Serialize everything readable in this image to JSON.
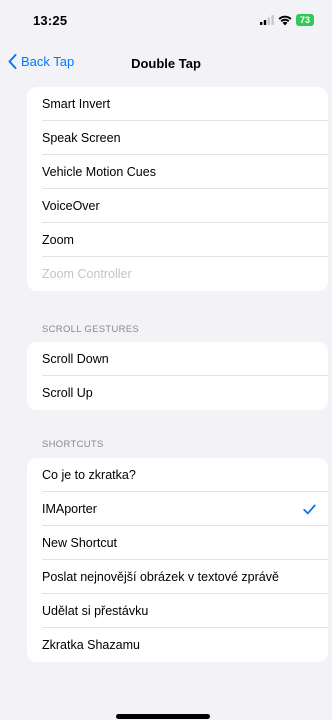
{
  "status_bar": {
    "time": "13:25",
    "battery": "73"
  },
  "nav": {
    "back_label": "Back Tap",
    "title": "Double Tap"
  },
  "groups": {
    "accessibility": {
      "items": [
        {
          "label": "Smart Invert"
        },
        {
          "label": "Speak Screen"
        },
        {
          "label": "Vehicle Motion Cues"
        },
        {
          "label": "VoiceOver"
        },
        {
          "label": "Zoom"
        },
        {
          "label": "Zoom Controller",
          "disabled": true
        }
      ]
    },
    "scroll_gestures": {
      "header": "SCROLL GESTURES",
      "items": [
        {
          "label": "Scroll Down"
        },
        {
          "label": "Scroll Up"
        }
      ]
    },
    "shortcuts": {
      "header": "SHORTCUTS",
      "items": [
        {
          "label": "Co je to zkratka?"
        },
        {
          "label": "IMAporter",
          "selected": true
        },
        {
          "label": "New Shortcut"
        },
        {
          "label": "Poslat nejnovější obrázek v textové zprávě"
        },
        {
          "label": "Udělat si přestávku"
        },
        {
          "label": "Zkratka Shazamu"
        }
      ]
    }
  },
  "colors": {
    "accent": "#007aff",
    "background": "#f2f2f7",
    "battery": "#34c759"
  }
}
